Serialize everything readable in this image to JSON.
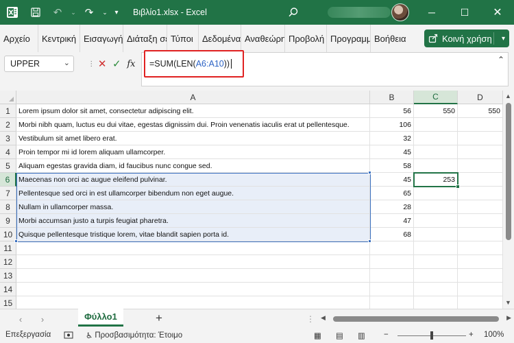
{
  "window": {
    "title": "Βιβλίο1.xlsx  -  Excel",
    "accent": "#217346"
  },
  "ribbon": {
    "tabs": [
      "Αρχείο",
      "Κεντρική",
      "Εισαγωγή",
      "Διάταξη σελίδας",
      "Τύποι",
      "Δεδομένα",
      "Αναθεώρηση",
      "Προβολή",
      "Προγραμματιστής",
      "Βοήθεια"
    ],
    "share_label": "Κοινή χρήση"
  },
  "formula_bar": {
    "name_box": "UPPER",
    "formula_prefix": "=SUM(LEN(",
    "formula_ref": "A6:A10",
    "formula_suffix": "))",
    "fx_label": "fx"
  },
  "grid": {
    "columns": [
      "A",
      "B",
      "C",
      "D"
    ],
    "rows": [
      {
        "n": "1",
        "a": "Lorem ipsum dolor sit amet, consectetur adipiscing elit.",
        "b": "56",
        "c": "550",
        "d": "550"
      },
      {
        "n": "2",
        "a": "Morbi nibh quam, luctus eu dui vitae, egestas dignissim dui. Proin venenatis iaculis erat ut pellentesque.",
        "b": "106",
        "c": "",
        "d": ""
      },
      {
        "n": "3",
        "a": "Vestibulum sit amet libero erat.",
        "b": "32",
        "c": "",
        "d": ""
      },
      {
        "n": "4",
        "a": "Proin tempor mi id lorem aliquam ullamcorper.",
        "b": "45",
        "c": "",
        "d": ""
      },
      {
        "n": "5",
        "a": "Aliquam egestas gravida diam, id faucibus nunc congue sed.",
        "b": "58",
        "c": "",
        "d": ""
      },
      {
        "n": "6",
        "a": "Maecenas non orci ac augue eleifend pulvinar.",
        "b": "45",
        "c": "253",
        "d": ""
      },
      {
        "n": "7",
        "a": "Pellentesque sed orci in est ullamcorper bibendum non eget augue.",
        "b": "65",
        "c": "",
        "d": ""
      },
      {
        "n": "8",
        "a": "Nullam in ullamcorper massa.",
        "b": "28",
        "c": "",
        "d": ""
      },
      {
        "n": "9",
        "a": "Morbi accumsan justo a turpis feugiat pharetra.",
        "b": "47",
        "c": "",
        "d": ""
      },
      {
        "n": "10",
        "a": "Quisque pellentesque tristique lorem, vitae blandit sapien porta id.",
        "b": "68",
        "c": "",
        "d": ""
      },
      {
        "n": "11",
        "a": "",
        "b": "",
        "c": "",
        "d": ""
      },
      {
        "n": "12",
        "a": "",
        "b": "",
        "c": "",
        "d": ""
      },
      {
        "n": "13",
        "a": "",
        "b": "",
        "c": "",
        "d": ""
      },
      {
        "n": "14",
        "a": "",
        "b": "",
        "c": "",
        "d": ""
      },
      {
        "n": "15",
        "a": "",
        "b": "",
        "c": "",
        "d": ""
      }
    ]
  },
  "sheets": {
    "active": "Φύλλο1"
  },
  "status": {
    "mode": "Επεξεργασία",
    "accessibility": "Προσβασιμότητα: Έτοιμο",
    "zoom": "100%"
  }
}
